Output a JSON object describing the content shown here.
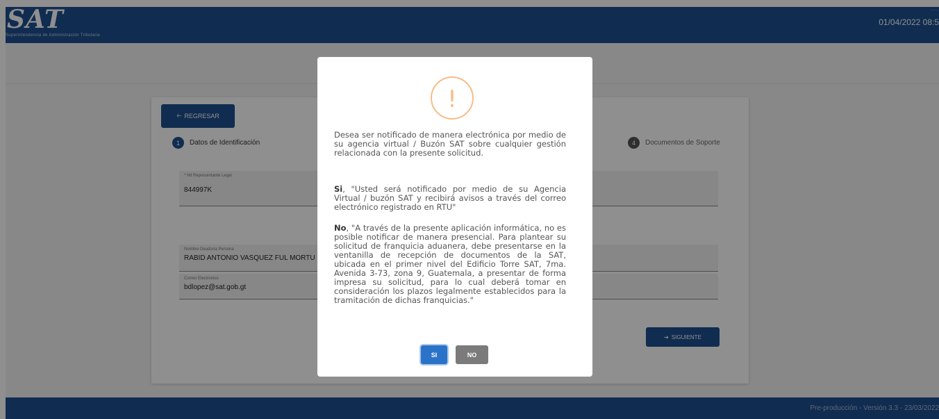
{
  "header": {
    "logo_text": "SAT",
    "logo_subtitle": "Superintendencia de Administración Tributaria",
    "datetime": "01/04/2022 08:5"
  },
  "toolbar": {
    "back_label": "REGRESAR",
    "back_icon": "arrow-left-icon"
  },
  "stepper": {
    "steps": [
      {
        "number": "1",
        "label": "Datos de Identificación"
      },
      {
        "number": "4",
        "label": "Documentos de Soporte"
      }
    ]
  },
  "form": {
    "nit": {
      "label": "* Nit Representante Legal",
      "value": "844997K"
    },
    "name": {
      "label": "Nombre Deudor/a Persona",
      "value": "RABID ANTONIO VASQUEZ FUL MORTU"
    },
    "email": {
      "label": "Correo Electronico",
      "value": "bdlopez@sat.gob.gt"
    },
    "next_label": "SIGUIENTE",
    "next_icon": "arrow-right-icon"
  },
  "footer": {
    "text": "Pre-producción - Versión 3.3 - 23/03/2022"
  },
  "modal": {
    "icon": "!",
    "question": "Desea ser notificado de manera electrónica por medio de su agencia virtual / Buzón SAT sobre cualquier gestión relacionada con la presente solicitud.",
    "si_bold": "Si",
    "si_text": ", \"Usted será notificado por medio de su Agencia Virtual / buzón SAT y recibirá avisos a través del correo electrónico registrado en RTU\"",
    "no_bold": "No",
    "no_text": ", \"A través de la presente aplicación informática, no es posible notificar de manera presencial. Para plantear su solicitud de franquicia aduanera, debe presentarse en la ventanilla de recepción de documentos de la SAT, ubicada en el primer nivel del Edificio Torre SAT, 7ma. Avenida 3-73, zona 9, Guatemala, a presentar de forma impresa su solicitud, para lo cual deberá tomar en consideración los plazos legalmente establecidos para la tramitación de dichas franquicias.\"",
    "btn_si": "SI",
    "btn_no": "NO"
  },
  "colors": {
    "brand": "#1d4f8f",
    "warning": "#f8bb86",
    "confirm": "#2b73c8",
    "cancel": "#7b7b7b"
  }
}
